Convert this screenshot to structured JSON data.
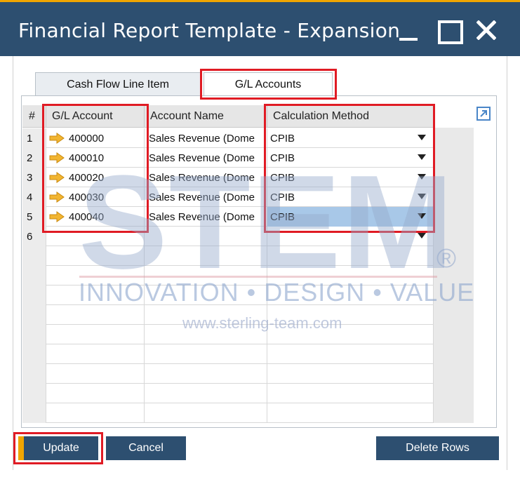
{
  "window": {
    "title": "Financial Report Template - Expansion",
    "accent_color": "#f0a500",
    "titlebar_color": "#2d4f70"
  },
  "tabs": [
    {
      "label": "Cash Flow Line Item",
      "active": false
    },
    {
      "label": "G/L Accounts",
      "active": true
    }
  ],
  "grid": {
    "headers": {
      "num": "#",
      "account": "G/L Account",
      "name": "Account Name",
      "calc": "Calculation Method"
    },
    "rows": [
      {
        "num": "1",
        "account": "400000",
        "name": "Sales Revenue (Dome",
        "calc": "CPIB"
      },
      {
        "num": "2",
        "account": "400010",
        "name": "Sales Revenue (Dome",
        "calc": "CPIB"
      },
      {
        "num": "3",
        "account": "400020",
        "name": "Sales Revenue (Dome",
        "calc": "CPIB"
      },
      {
        "num": "4",
        "account": "400030",
        "name": "Sales Revenue (Dome",
        "calc": "CPIB"
      },
      {
        "num": "5",
        "account": "400040",
        "name": "Sales Revenue (Dome",
        "calc": "CPIB"
      },
      {
        "num": "6",
        "account": "",
        "name": "",
        "calc": ""
      }
    ],
    "selected_row": "5"
  },
  "buttons": {
    "update": "Update",
    "cancel": "Cancel",
    "delete_rows": "Delete Rows"
  },
  "watermark": {
    "brand": "STEM",
    "registered": "®",
    "tagline": "INNOVATION • DESIGN • VALUE",
    "url": "www.sterling-team.com"
  },
  "icons": {
    "link_arrow": "arrow-right-icon",
    "expand": "expand-icon",
    "dropdown": "chevron-down-icon"
  }
}
